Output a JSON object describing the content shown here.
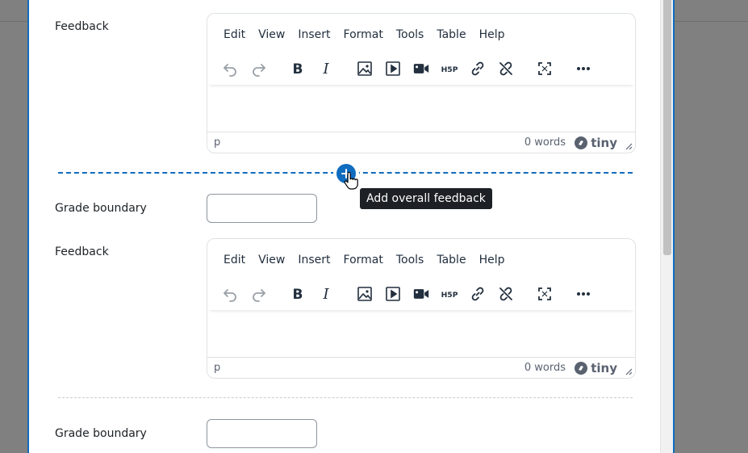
{
  "editor_menu": [
    "Edit",
    "View",
    "Insert",
    "Format",
    "Tools",
    "Table",
    "Help"
  ],
  "toolbar_icons": [
    "undo-icon",
    "redo-icon",
    "bold-icon",
    "italic-icon",
    "image-icon",
    "media-icon",
    "video-icon",
    "h5p-icon",
    "link-icon",
    "unlink-icon",
    "fullscreen-icon",
    "more-icon"
  ],
  "sections": [
    {
      "feedback_label": "Feedback",
      "statusbar": {
        "path": "p",
        "word_count": "0 words",
        "brand": "tiny"
      }
    },
    {
      "grade_label": "Grade boundary",
      "grade_value": "",
      "feedback_label": "Feedback",
      "statusbar": {
        "path": "p",
        "word_count": "0 words",
        "brand": "tiny"
      }
    },
    {
      "grade_label": "Grade boundary",
      "grade_value": ""
    }
  ],
  "add_feedback_tooltip": "Add overall feedback",
  "colors": {
    "accent": "#0f6cbf",
    "backdrop": "#808080",
    "tooltip_bg": "#1d2125"
  }
}
